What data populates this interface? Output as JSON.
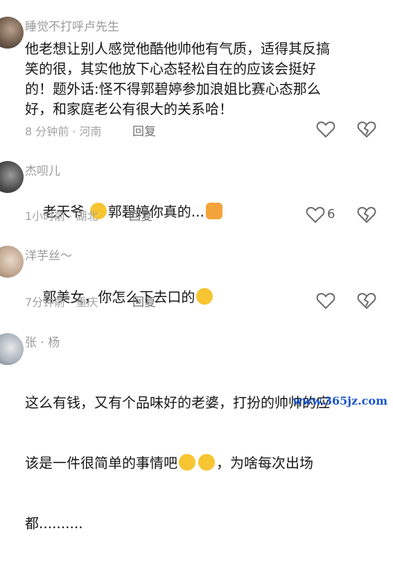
{
  "comments": [
    {
      "username": "睡觉不打呼卢先生",
      "text": "他老想让别人感觉他酷他帅他有气质，适得其反搞\n笑的很，其实他放下心态轻松自在的应该会挺好\n的！题外话:怪不得郭碧婷参加浪姐比赛心态那么\n好，和家庭老公有很大的关系哈！",
      "meta": "8 分钟前 · 河南",
      "reply_label": "回复",
      "like_count": ""
    },
    {
      "username": "杰呗儿",
      "text_before": "老天爷 ",
      "text_middle": "郭碧婷你真的...",
      "emoji1": "pleading-face-emoji",
      "emoji2": "thumbs-up-emoji",
      "meta": "1小时前 · 湖北",
      "reply_label": "回复",
      "like_count": "6"
    },
    {
      "username": "洋芋丝～",
      "text": "郭美女，你怎么下去口的",
      "emoji": "rolling-on-floor-laughing-emoji",
      "meta": "7分钟前 · 重庆",
      "reply_label": "回复",
      "like_count": ""
    },
    {
      "username": "张 · 杨",
      "text_line1": "这么有钱，又有个品味好的老婆，打扮的帅帅的应",
      "text_line2a": "该是一件很简单的事情吧",
      "text_line2b": "，为啥每次出场",
      "text_line3": "都..........",
      "emoji": "smirking-face-emoji"
    }
  ],
  "watermark": "www.365jz.com",
  "colors": {
    "text": "#161616",
    "meta": "#a3a3a3",
    "username": "#9a9a9a",
    "watermark": "#1a55c9"
  }
}
